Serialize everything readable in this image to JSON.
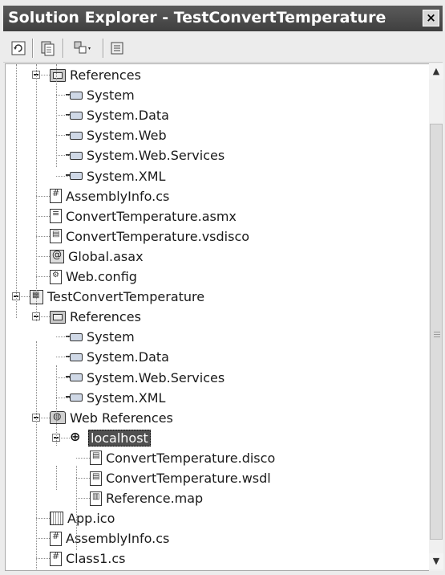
{
  "window": {
    "title": "Solution Explorer - TestConvertTemperature",
    "close_label": "×"
  },
  "toolbar": {
    "buttons": [
      "refresh-icon",
      "show-all-files-icon",
      "copy-project-icon",
      "properties-icon"
    ]
  },
  "tree": {
    "selected": "localhost",
    "items": [
      {
        "label": "References",
        "icon": "references-folder-icon",
        "level": 1,
        "expanded": true
      },
      {
        "label": "System",
        "icon": "reference-icon",
        "level": 2
      },
      {
        "label": "System.Data",
        "icon": "reference-icon",
        "level": 2
      },
      {
        "label": "System.Web",
        "icon": "reference-icon",
        "level": 2
      },
      {
        "label": "System.Web.Services",
        "icon": "reference-icon",
        "level": 2
      },
      {
        "label": "System.XML",
        "icon": "reference-icon",
        "level": 2
      },
      {
        "label": "AssemblyInfo.cs",
        "icon": "cs-file-icon",
        "level": 1
      },
      {
        "label": "ConvertTemperature.asmx",
        "icon": "asmx-file-icon",
        "level": 1
      },
      {
        "label": "ConvertTemperature.vsdisco",
        "icon": "vsdisco-file-icon",
        "level": 1
      },
      {
        "label": "Global.asax",
        "icon": "global-asax-icon",
        "level": 1
      },
      {
        "label": "Web.config",
        "icon": "config-file-icon",
        "level": 1
      },
      {
        "label": "TestConvertTemperature",
        "icon": "project-icon",
        "level": 0,
        "expanded": true
      },
      {
        "label": "References",
        "icon": "references-folder-icon",
        "level": 1,
        "expanded": true
      },
      {
        "label": "System",
        "icon": "reference-icon",
        "level": 2
      },
      {
        "label": "System.Data",
        "icon": "reference-icon",
        "level": 2
      },
      {
        "label": "System.Web.Services",
        "icon": "reference-icon",
        "level": 2
      },
      {
        "label": "System.XML",
        "icon": "reference-icon",
        "level": 2
      },
      {
        "label": "Web References",
        "icon": "web-references-folder-icon",
        "level": 1,
        "expanded": true
      },
      {
        "label": "localhost",
        "icon": "web-reference-icon",
        "level": 2,
        "expanded": true
      },
      {
        "label": "ConvertTemperature.disco",
        "icon": "disco-file-icon",
        "level": 3
      },
      {
        "label": "ConvertTemperature.wsdl",
        "icon": "wsdl-file-icon",
        "level": 3
      },
      {
        "label": "Reference.map",
        "icon": "map-file-icon",
        "level": 3
      },
      {
        "label": "App.ico",
        "icon": "ico-file-icon",
        "level": 1
      },
      {
        "label": "AssemblyInfo.cs",
        "icon": "cs-file-icon",
        "level": 1
      },
      {
        "label": "Class1.cs",
        "icon": "cs-file-icon",
        "level": 1
      }
    ]
  },
  "scrollbar": {
    "up_label": "▲",
    "down_label": "▼"
  }
}
